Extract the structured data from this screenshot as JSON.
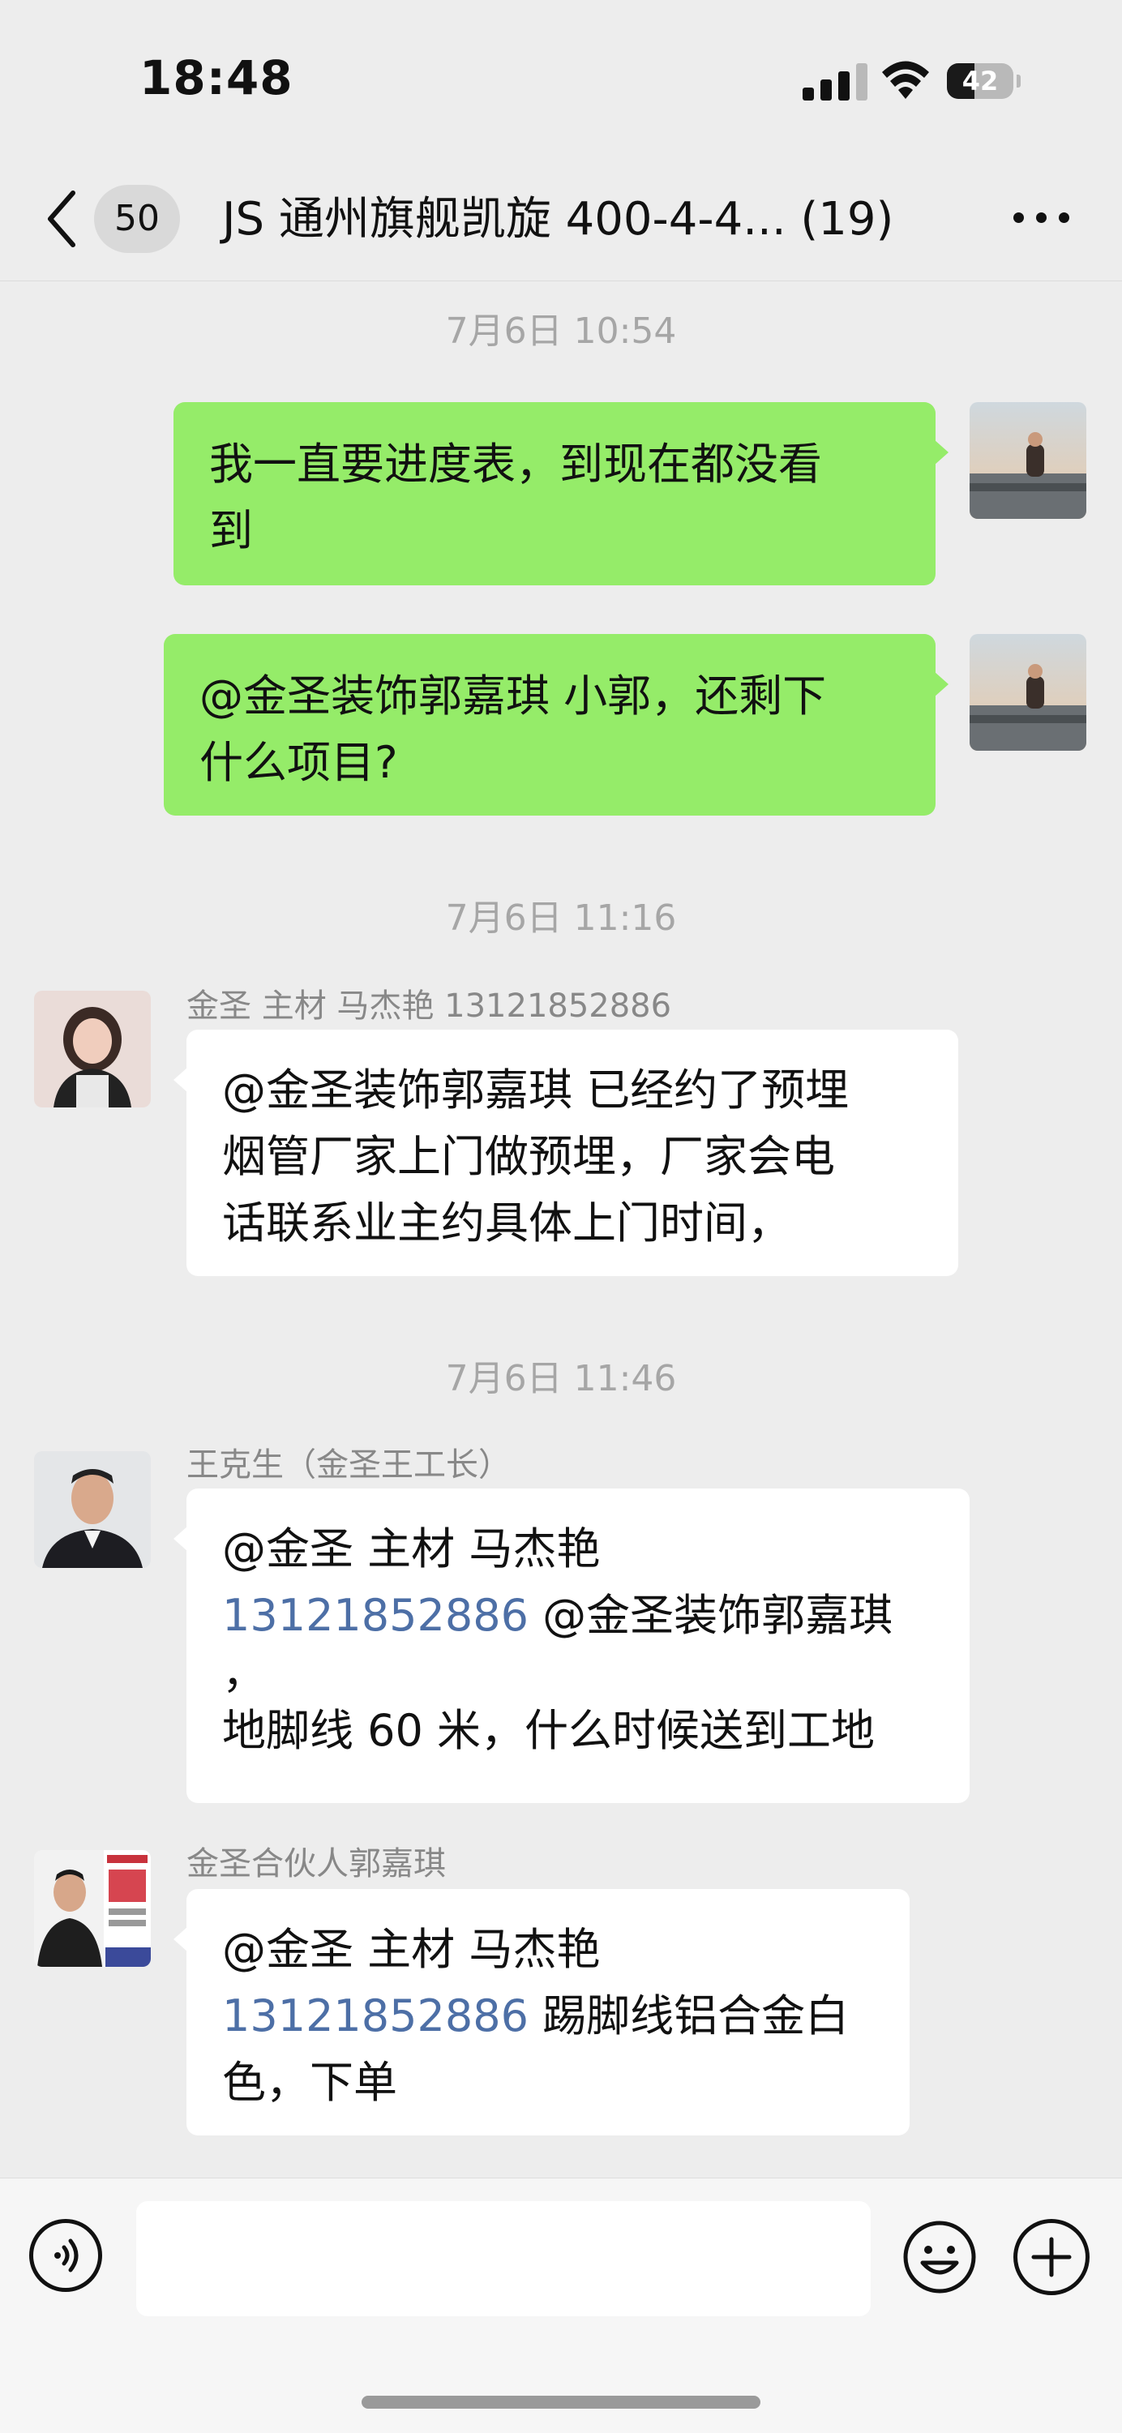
{
  "status_bar": {
    "time": "18:48",
    "battery_level": "42",
    "battery_fraction": 0.42
  },
  "header": {
    "unread_count": "50",
    "title": "JS 通州旗舰凯旋 400-4-4... (19)",
    "icons": [
      "chevron-left-icon",
      "more-icon"
    ]
  },
  "messages": [
    {
      "type": "timestamp",
      "text": "7月6日 10:54"
    },
    {
      "type": "sent",
      "lines": [
        "我一直要进度表，到现在都没看",
        "到"
      ]
    },
    {
      "type": "sent",
      "lines": [
        "@金圣装饰郭嘉琪 小郭，还剩下",
        "什么项目?"
      ]
    },
    {
      "type": "timestamp",
      "text": "7月6日 11:16"
    },
    {
      "type": "received",
      "sender": "金圣 主材 马杰艳 13121852886",
      "lines": [
        "@金圣装饰郭嘉琪 已经约了预埋",
        "烟管厂家上门做预埋，厂家会电",
        "话联系业主约具体上门时间，"
      ]
    },
    {
      "type": "timestamp",
      "text": "7月6日 11:46"
    },
    {
      "type": "received",
      "sender": "王克生（金圣王工长）",
      "line1": "@金圣 主材 马杰艳",
      "line2_link": "13121852886",
      "line2_rest": " @金圣装饰郭嘉琪",
      "line3": "，",
      "line4": "地脚线 60 米，什么时候送到工地"
    },
    {
      "type": "received",
      "sender": "金圣合伙人郭嘉琪",
      "line1": "@金圣 主材 马杰艳",
      "line2_link": "13121852886",
      "line2_rest": " 踢脚线铝合金白",
      "line3": "色，下单"
    }
  ],
  "input_bar": {
    "placeholder": "",
    "icons": [
      "voice-icon",
      "emoji-icon",
      "plus-icon"
    ]
  },
  "colors": {
    "sent_bubble": "#95ec69",
    "received_bubble": "#ffffff",
    "background": "#ededed",
    "link": "#4d6fa6"
  }
}
